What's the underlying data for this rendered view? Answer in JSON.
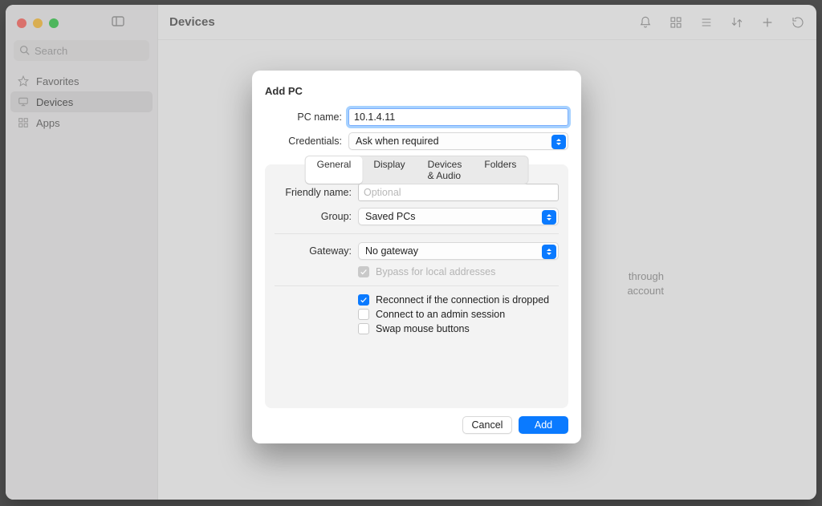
{
  "window": {
    "title": "Devices"
  },
  "sidebar": {
    "search_placeholder": "Search",
    "items": [
      {
        "icon": "star",
        "label": "Favorites"
      },
      {
        "icon": "display",
        "label": "Devices",
        "selected": true
      },
      {
        "icon": "grid",
        "label": "Apps"
      }
    ]
  },
  "toolbar": {
    "icons": [
      "sidebar-toggle",
      "bell",
      "grid-view",
      "list-view",
      "sort",
      "add",
      "reload"
    ]
  },
  "background_hint": {
    "line1": "through",
    "line2": "account"
  },
  "dialog": {
    "title": "Add PC",
    "labels": {
      "pc_name": "PC name:",
      "credentials": "Credentials:",
      "friendly_name": "Friendly name:",
      "group": "Group:",
      "gateway": "Gateway:"
    },
    "pc_name_value": "10.1.4.11",
    "credentials_value": "Ask when required",
    "tabs": [
      "General",
      "Display",
      "Devices & Audio",
      "Folders"
    ],
    "active_tab_index": 0,
    "friendly_name_placeholder": "Optional",
    "friendly_name_value": "",
    "group_value": "Saved PCs",
    "gateway_value": "No gateway",
    "bypass_label": "Bypass for local addresses",
    "bypass_checked": true,
    "bypass_enabled": false,
    "checks": [
      {
        "label": "Reconnect if the connection is dropped",
        "checked": true
      },
      {
        "label": "Connect to an admin session",
        "checked": false
      },
      {
        "label": "Swap mouse buttons",
        "checked": false
      }
    ],
    "buttons": {
      "cancel": "Cancel",
      "add": "Add"
    }
  },
  "colors": {
    "accent": "#0a7aff"
  }
}
